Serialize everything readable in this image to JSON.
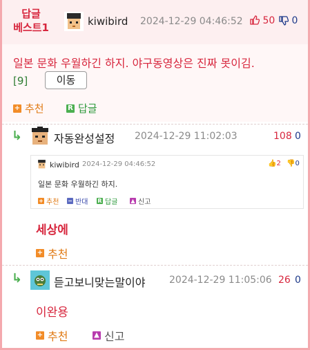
{
  "best": {
    "badge_line1": "답글",
    "badge_line2": "베스트1",
    "author": "kiwibird",
    "date": "2024-12-29 04:46:52",
    "up_count": "50",
    "down_count": "0",
    "text": "일본 문화 우월하긴 하지. 야구동영상은 진짜 못이김.",
    "comment_count": "[9]",
    "move_label": "이동",
    "recommend_label": "추천",
    "reply_label": "답글"
  },
  "replies": [
    {
      "author": "자동완성설정",
      "date": "2024-12-29 11:02:03",
      "up_count": "108",
      "down_count": "0",
      "quote": {
        "author": "kiwibird",
        "date": "2024-12-29 04:46:52",
        "up_count": "2",
        "down_count": "0",
        "text": "일본 문화 우월하긴 하지.",
        "recommend_label": "추천",
        "oppose_label": "반대",
        "reply_label": "답글",
        "report_label": "신고"
      },
      "text": "세상에",
      "recommend_label": "추천"
    },
    {
      "author": "듣고보니맞는말이야",
      "date": "2024-12-29 11:05:06",
      "up_count": "26",
      "down_count": "0",
      "text": "이완용",
      "recommend_label": "추천",
      "report_label": "신고"
    }
  ],
  "icons": {
    "thumb_up": "thumbs-up-icon",
    "thumb_down": "thumbs-down-icon",
    "plus": "plus-icon",
    "reply": "reply-r-icon",
    "arrow": "reply-arrow-icon",
    "report": "siren-icon"
  },
  "colors": {
    "accent_red": "#d7263d",
    "border_pink": "#f4a9ae",
    "green": "#2e9a3c",
    "navy": "#1e3a8a",
    "orange": "#e07a14"
  }
}
